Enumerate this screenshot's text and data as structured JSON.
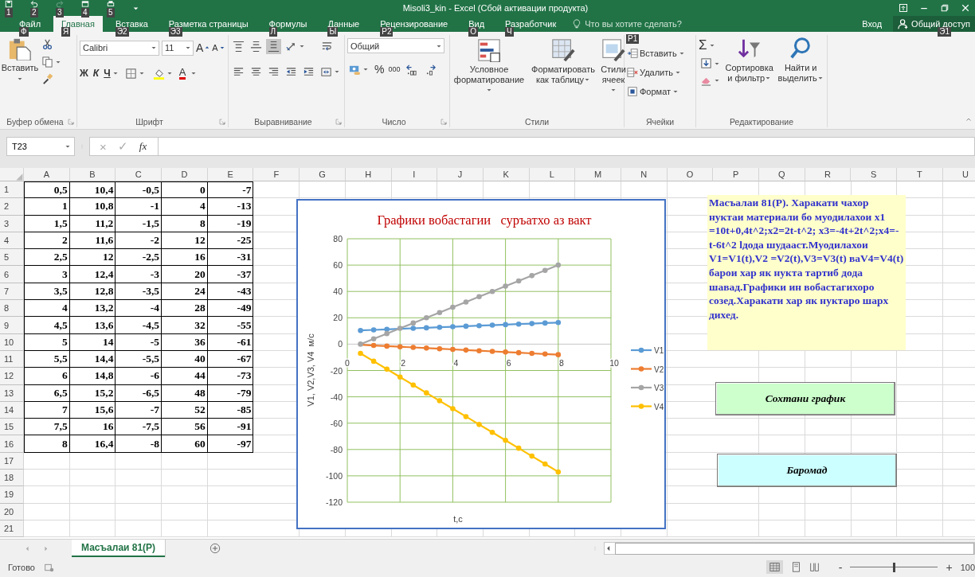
{
  "title_bar": {
    "quick_access_keytips": [
      "1",
      "2",
      "3",
      "4",
      "5"
    ],
    "title": "Misoli3_kin - Excel (Сбой активации продукта)"
  },
  "ribbon_tabs": [
    {
      "label": "Файл",
      "keytip": "Ф",
      "selected": false
    },
    {
      "label": "Главная",
      "keytip": "Я",
      "selected": true
    },
    {
      "label": "Вставка",
      "keytip": "Э2",
      "selected": false
    },
    {
      "label": "Разметка страницы",
      "keytip": "Э3",
      "selected": false
    },
    {
      "label": "Формулы",
      "keytip": "Л",
      "selected": false
    },
    {
      "label": "Данные",
      "keytip": "Ы",
      "selected": false
    },
    {
      "label": "Рецензирование",
      "keytip": "Р2",
      "selected": false
    },
    {
      "label": "Вид",
      "keytip": "О",
      "selected": false
    },
    {
      "label": "Разработчик",
      "keytip": "Ч",
      "selected": false
    }
  ],
  "tell_me": {
    "placeholder": "Что вы хотите сделать?"
  },
  "account": {
    "sign_in": "Вход",
    "share": "Общий доступ",
    "share_keytip": "Э1"
  },
  "ribbon": {
    "clipboard": {
      "label": "Буфер обмена",
      "paste": "Вставить"
    },
    "font": {
      "label": "Шрифт",
      "font_name": "Calibri",
      "font_size": "11",
      "grow": "A",
      "shrink": "A",
      "bold": "Ж",
      "italic": "К",
      "underline": "Ч",
      "font_color": "A"
    },
    "alignment": {
      "label": "Выравнивание",
      "bottom_aligned": true
    },
    "number": {
      "label": "Число",
      "format": "Общий",
      "percent": "%",
      "thousands": "000"
    },
    "styles": {
      "label": "Стили",
      "conditional": "Условное форматирование",
      "format_table": "Форматировать как таблицу",
      "cell_styles": "Стили ячеек"
    },
    "cells": {
      "label": "Ячейки",
      "keytip": "Р1",
      "insert": "Вставить",
      "delete": "Удалить",
      "format": "Формат"
    },
    "editing": {
      "label": "Редактирование",
      "autosum": "Σ",
      "sort": "Сортировка и фильтр",
      "find": "Найти и выделить"
    }
  },
  "formula_bar": {
    "name_box": "T23",
    "cancel": "×",
    "enter": "✓",
    "function": "fx"
  },
  "sheet": {
    "columns": [
      "A",
      "B",
      "C",
      "D",
      "E",
      "F",
      "G",
      "H",
      "I",
      "J",
      "K",
      "L",
      "M",
      "N",
      "O",
      "P",
      "Q",
      "R",
      "S",
      "T",
      "U"
    ],
    "row_numbers": [
      "1",
      "2",
      "3",
      "4",
      "5",
      "6",
      "7",
      "8",
      "9",
      "10",
      "11",
      "12",
      "13",
      "14",
      "15",
      "16",
      "17",
      "18",
      "19",
      "20",
      "21"
    ],
    "rows": [
      [
        "0,5",
        "10,4",
        "-0,5",
        "0",
        "-7"
      ],
      [
        "1",
        "10,8",
        "-1",
        "4",
        "-13"
      ],
      [
        "1,5",
        "11,2",
        "-1,5",
        "8",
        "-19"
      ],
      [
        "2",
        "11,6",
        "-2",
        "12",
        "-25"
      ],
      [
        "2,5",
        "12",
        "-2,5",
        "16",
        "-31"
      ],
      [
        "3",
        "12,4",
        "-3",
        "20",
        "-37"
      ],
      [
        "3,5",
        "12,8",
        "-3,5",
        "24",
        "-43"
      ],
      [
        "4",
        "13,2",
        "-4",
        "28",
        "-49"
      ],
      [
        "4,5",
        "13,6",
        "-4,5",
        "32",
        "-55"
      ],
      [
        "5",
        "14",
        "-5",
        "36",
        "-61"
      ],
      [
        "5,5",
        "14,4",
        "-5,5",
        "40",
        "-67"
      ],
      [
        "6",
        "14,8",
        "-6",
        "44",
        "-73"
      ],
      [
        "6,5",
        "15,2",
        "-6,5",
        "48",
        "-79"
      ],
      [
        "7",
        "15,6",
        "-7",
        "52",
        "-85"
      ],
      [
        "7,5",
        "16",
        "-7,5",
        "56",
        "-91"
      ],
      [
        "8",
        "16,4",
        "-8",
        "60",
        "-97"
      ]
    ]
  },
  "chart": {
    "chart_data": {
      "type": "line",
      "title": "Графики вобастагии   суръатхо аз вакт",
      "xlabel": "t,c",
      "ylabel": "V1, V2,V3, V4  м/с",
      "x": [
        0.5,
        1,
        1.5,
        2,
        2.5,
        3,
        3.5,
        4,
        4.5,
        5,
        5.5,
        6,
        6.5,
        7,
        7.5,
        8
      ],
      "series": [
        {
          "name": "V1",
          "color": "#5b9bd5",
          "marker": true,
          "values": [
            10.4,
            10.8,
            11.2,
            11.6,
            12,
            12.4,
            12.8,
            13.2,
            13.6,
            14,
            14.4,
            14.8,
            15.2,
            15.6,
            16,
            16.4
          ]
        },
        {
          "name": "V2",
          "color": "#ed7d31",
          "marker": true,
          "values": [
            -0.5,
            -1,
            -1.5,
            -2,
            -2.5,
            -3,
            -3.5,
            -4,
            -4.5,
            -5,
            -5.5,
            -6,
            -6.5,
            -7,
            -7.5,
            -8
          ]
        },
        {
          "name": "V3",
          "color": "#a5a5a5",
          "marker": true,
          "values": [
            0,
            4,
            8,
            12,
            16,
            20,
            24,
            28,
            32,
            36,
            40,
            44,
            48,
            52,
            56,
            60
          ]
        },
        {
          "name": "V4",
          "color": "#ffc000",
          "marker": true,
          "values": [
            -7,
            -13,
            -19,
            -25,
            -31,
            -37,
            -43,
            -49,
            -55,
            -61,
            -67,
            -73,
            -79,
            -85,
            -91,
            -97
          ]
        }
      ],
      "grid": true,
      "legend": true,
      "xlim": [
        0,
        10
      ],
      "ylim": [
        -120,
        80
      ],
      "xticks": [
        {
          "value": 0,
          "label": "0"
        },
        {
          "value": 2,
          "label": "2"
        },
        {
          "value": 4,
          "label": "4"
        },
        {
          "value": 6,
          "label": "6"
        },
        {
          "value": 8,
          "label": "8"
        },
        {
          "value": 10,
          "label": "10"
        }
      ],
      "yticks": [
        {
          "value": -120,
          "label": "-120"
        },
        {
          "value": -100,
          "label": "-100"
        },
        {
          "value": -80,
          "label": "-80"
        },
        {
          "value": -60,
          "label": "-60"
        },
        {
          "value": -40,
          "label": "-40"
        },
        {
          "value": -20,
          "label": "-20"
        },
        {
          "value": 0,
          "label": "0"
        },
        {
          "value": 20,
          "label": "20"
        },
        {
          "value": 40,
          "label": "40"
        },
        {
          "value": 60,
          "label": "60"
        },
        {
          "value": 80,
          "label": "80"
        }
      ]
    }
  },
  "text_box": "Масъалаи 81(Р). Харакати чахор нуктаи материали бо муодилахои  x1 =10t+0,4t^2;x2=2t-t^2; x3=-4t+2t^2;x4=-t-6t^2 lдода шудааст.Муодилахои V1=V1(t),V2 =V2(t),V3=V3(t) ваV4=V4(t) барои хар як нукта тартиб дода шавад.Графики ин вобастагихоро созед.Харакати хар як нуктаро шарх дихед.",
  "sheet_buttons": [
    {
      "label": "Сохтани график",
      "color": "#ccffcc"
    },
    {
      "label": "Баромад",
      "color": "#ccffff"
    }
  ],
  "sheet_tabs": [
    {
      "label": "Масъалаи 81(Р)",
      "selected": true
    }
  ],
  "status_bar": {
    "status": "Готово",
    "zoom_out": "-",
    "zoom_in": "+",
    "zoom": {
      "level": 0.5
    },
    "zoom_reading": "100"
  }
}
